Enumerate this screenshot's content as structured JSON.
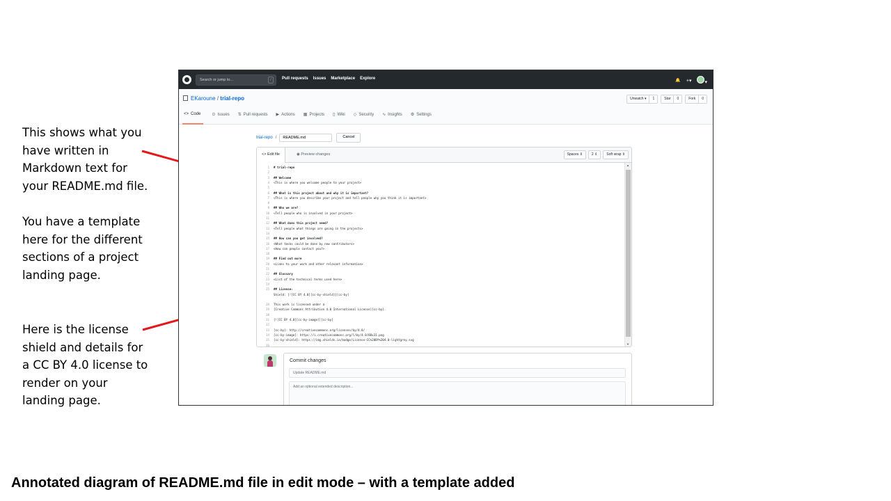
{
  "annotations": {
    "note1": [
      "This shows what you",
      "have written in",
      "Markdown text for",
      "your README.md file."
    ],
    "note2": [
      "You have a template",
      "here for the different",
      "sections of a project",
      "landing page."
    ],
    "note3": [
      "Here is the license",
      "shield and details for",
      "a CC BY 4.0 license to",
      "render on your",
      "landing page."
    ],
    "caption": "Annotated diagram of README.md file in edit mode – with a template added",
    "arrow_color": "#e3191b"
  },
  "github": {
    "search_placeholder": "Search or jump to...",
    "search_key": "/",
    "nav": [
      "Pull requests",
      "Issues",
      "Marketplace",
      "Explore"
    ],
    "bell": "🔔",
    "plus": "+▾",
    "avatar_caret": "▾"
  },
  "repo": {
    "owner": "EKaroune",
    "separator": "/",
    "name": "trial-repo",
    "watch_label": "Unwatch ▾",
    "watch_count": "1",
    "star_label": "Star",
    "star_count": "0",
    "fork_label": "Fork",
    "fork_count": "0",
    "tabs": [
      "Code",
      "Issues",
      "Pull requests",
      "Actions",
      "Projects",
      "Wiki",
      "Security",
      "Insights",
      "Settings"
    ]
  },
  "editor": {
    "breadcrumb_repo": "trial-repo",
    "breadcrumb_sep": "/",
    "filename": "README.md",
    "cancel_label": "Cancel",
    "edit_tab": "Edit file",
    "preview_tab": "Preview changes",
    "indent_mode": "Spaces",
    "indent_size": "2",
    "wrap_mode": "Soft wrap",
    "lines": [
      {
        "n": "1",
        "t": "# trial-repo",
        "h": true
      },
      {
        "n": "2",
        "t": ""
      },
      {
        "n": "3",
        "t": "## Welcome",
        "h": true
      },
      {
        "n": "4",
        "t": "<This is where you welcome people to your project>"
      },
      {
        "n": "5",
        "t": ""
      },
      {
        "n": "6",
        "t": "## What is this project about and why it is important?",
        "h": true
      },
      {
        "n": "7",
        "t": "<This is where you describe your project and tell people why you think it is important>"
      },
      {
        "n": "8",
        "t": ""
      },
      {
        "n": "9",
        "t": "## Who we are?",
        "h": true
      },
      {
        "n": "10",
        "t": "<Tell people who is involved in your project>"
      },
      {
        "n": "11",
        "t": ""
      },
      {
        "n": "12",
        "t": "## What does this project need?",
        "h": true
      },
      {
        "n": "13",
        "t": "<Tell people what things are going in the projects>"
      },
      {
        "n": "14",
        "t": ""
      },
      {
        "n": "15",
        "t": "## How can you get involved?",
        "h": true
      },
      {
        "n": "16",
        "t": "<What tasks could be done by new contributors>"
      },
      {
        "n": "17",
        "t": "<How can people contact you?>"
      },
      {
        "n": "18",
        "t": ""
      },
      {
        "n": "19",
        "t": "## Find out more",
        "h": true
      },
      {
        "n": "20",
        "t": "<Links to your work and other relevant information>"
      },
      {
        "n": "21",
        "t": ""
      },
      {
        "n": "22",
        "t": "## Glossary",
        "h": true
      },
      {
        "n": "23",
        "t": "<List of the technical terms used here>"
      },
      {
        "n": "24",
        "t": ""
      },
      {
        "n": "25",
        "t": "## License:",
        "h": true
      },
      {
        "n": "",
        "t": "Shield: [![CC BY 4.0][cc-by-shield]][cc-by]"
      },
      {
        "n": "",
        "t": ""
      },
      {
        "n": "28",
        "t": "This work is licensed under a"
      },
      {
        "n": "29",
        "t": "[Creative Commons Attribution 4.0 International License][cc-by]."
      },
      {
        "n": "30",
        "t": ""
      },
      {
        "n": "31",
        "t": "[![CC BY 4.0][cc-by-image]][cc-by]"
      },
      {
        "n": "32",
        "t": ""
      },
      {
        "n": "33",
        "t": "[cc-by]: http://creativecommons.org/licenses/by/4.0/"
      },
      {
        "n": "34",
        "t": "[cc-by-image]: https://i.creativecommons.org/l/by/4.0/88x31.png"
      },
      {
        "n": "35",
        "t": "[cc-by-shield]: https://img.shields.io/badge/License-CC%20BY%204.0-lightgrey.svg"
      },
      {
        "n": "36",
        "t": ""
      }
    ]
  },
  "commit": {
    "heading": "Commit changes",
    "title_placeholder": "Update README.md",
    "desc_placeholder": "Add an optional extended description..."
  }
}
